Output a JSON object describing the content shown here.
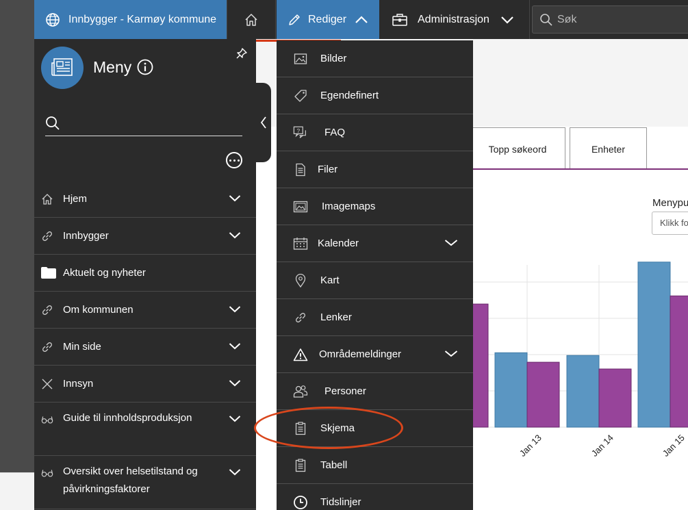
{
  "topbar": {
    "site_label": "Innbygger - Karmøy kommune",
    "edit_label": "Rediger",
    "admin_label": "Administrasjon",
    "search_placeholder": "Søk"
  },
  "sidebar": {
    "title": "Meny",
    "items": [
      {
        "label": "Hjem",
        "icon": "home-icon",
        "expandable": true
      },
      {
        "label": "Innbygger",
        "icon": "link-icon",
        "expandable": true
      },
      {
        "label": "Aktuelt og nyheter",
        "icon": "folder-icon",
        "expandable": false
      },
      {
        "label": "Om kommunen",
        "icon": "link-icon",
        "expandable": true
      },
      {
        "label": "Min side",
        "icon": "link-icon",
        "expandable": true
      },
      {
        "label": "Innsyn",
        "icon": "x-icon",
        "expandable": true
      },
      {
        "label": "Guide til innholdsproduksjon",
        "icon": "glasses-icon",
        "expandable": true
      },
      {
        "label": "Oversikt over helsetilstand og påvirkningsfaktorer",
        "icon": "glasses-icon",
        "expandable": true
      }
    ]
  },
  "dropdown": {
    "items": [
      {
        "label": "Bilder",
        "icon": "image-icon"
      },
      {
        "label": "Egendefinert",
        "icon": "tag-icon"
      },
      {
        "label": "FAQ",
        "icon": "faq-icon"
      },
      {
        "label": "Filer",
        "icon": "file-icon"
      },
      {
        "label": "Imagemaps",
        "icon": "imagemap-icon"
      },
      {
        "label": "Kalender",
        "icon": "calendar-icon",
        "expandable": true
      },
      {
        "label": "Kart",
        "icon": "map-pin-icon"
      },
      {
        "label": "Lenker",
        "icon": "link-icon"
      },
      {
        "label": "Områdemeldinger",
        "icon": "warning-icon",
        "expandable": true
      },
      {
        "label": "Personer",
        "icon": "persons-icon"
      },
      {
        "label": "Skjema",
        "icon": "form-icon",
        "highlighted": true
      },
      {
        "label": "Tabell",
        "icon": "table-icon"
      },
      {
        "label": "Tidslinjer",
        "icon": "clock-icon"
      }
    ]
  },
  "page": {
    "tabs": [
      "Topp søkeord",
      "Enheter"
    ],
    "menypub_label": "Menypu",
    "menypub_placeholder": "Klikk fo"
  },
  "chart_data": {
    "type": "bar",
    "categories": [
      "Jan 13",
      "Jan 14",
      "Jan 15"
    ],
    "series": [
      {
        "values": [
          0.55,
          0.53,
          1.22
        ],
        "color": "#5b96c2"
      },
      {
        "values": [
          0.48,
          0.43,
          0.97
        ],
        "color": "#97449a"
      }
    ],
    "partial_previous_purple": 0.91,
    "ylim": [
      0,
      1.3
    ],
    "grid": true
  }
}
